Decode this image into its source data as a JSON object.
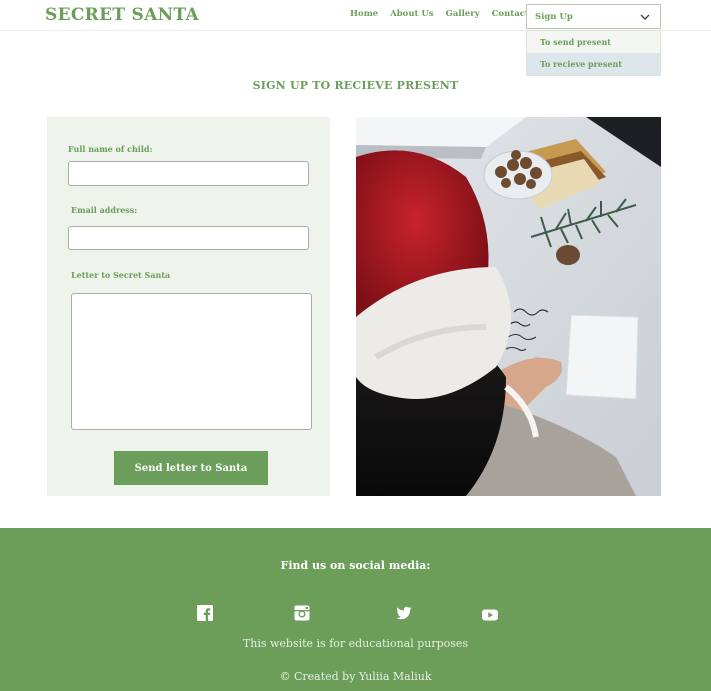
{
  "header": {
    "logo": "SECRET SANTA",
    "nav": [
      "Home",
      "About Us",
      "Gallery",
      "Contact Us"
    ],
    "dropdown": {
      "selected": "Sign Up",
      "options": [
        "To send present",
        "To recieve present"
      ]
    }
  },
  "main": {
    "title": "SIGN UP TO RECIEVE PRESENT",
    "form": {
      "name_label": "Full name of child:",
      "name_value": "",
      "email_label": "Email address:",
      "email_value": "",
      "letter_label": "Letter to Secret Santa",
      "letter_value": "",
      "submit_label": "Send letter to Santa"
    }
  },
  "footer": {
    "title": "Find us on social media:",
    "social": [
      "facebook-icon",
      "instagram-icon",
      "twitter-icon",
      "youtube-icon"
    ],
    "note": "This website is for educational purposes",
    "credit": "© Created by Yuliia Maliuk"
  },
  "colors": {
    "accent": "#6b9e5a",
    "panel": "#eef3ec",
    "white": "#ffffff"
  }
}
